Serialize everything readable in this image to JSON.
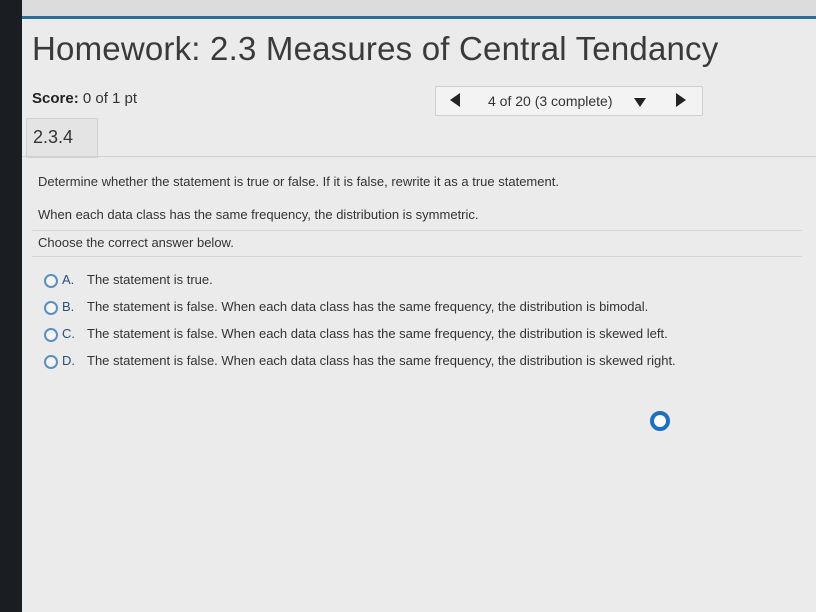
{
  "header": {
    "title": "Homework: 2.3 Measures of Central Tendancy"
  },
  "score": {
    "label": "Score:",
    "value": "0 of 1 pt"
  },
  "pager": {
    "status": "4 of 20 (3 complete)"
  },
  "question": {
    "number": "2.3.4",
    "instruction": "Determine whether the statement is true or false. If it is false, rewrite it as a true statement.",
    "statement": "When each data class has the same frequency, the distribution is symmetric.",
    "prompt": "Choose the correct answer below.",
    "options": [
      {
        "letter": "A.",
        "text": "The statement is true."
      },
      {
        "letter": "B.",
        "text": "The statement is false. When each data class has the same frequency, the distribution is bimodal."
      },
      {
        "letter": "C.",
        "text": "The statement is false. When each data class has the same frequency, the distribution is skewed left."
      },
      {
        "letter": "D.",
        "text": "The statement is false. When each data class has the same frequency, the distribution is skewed right."
      }
    ]
  }
}
